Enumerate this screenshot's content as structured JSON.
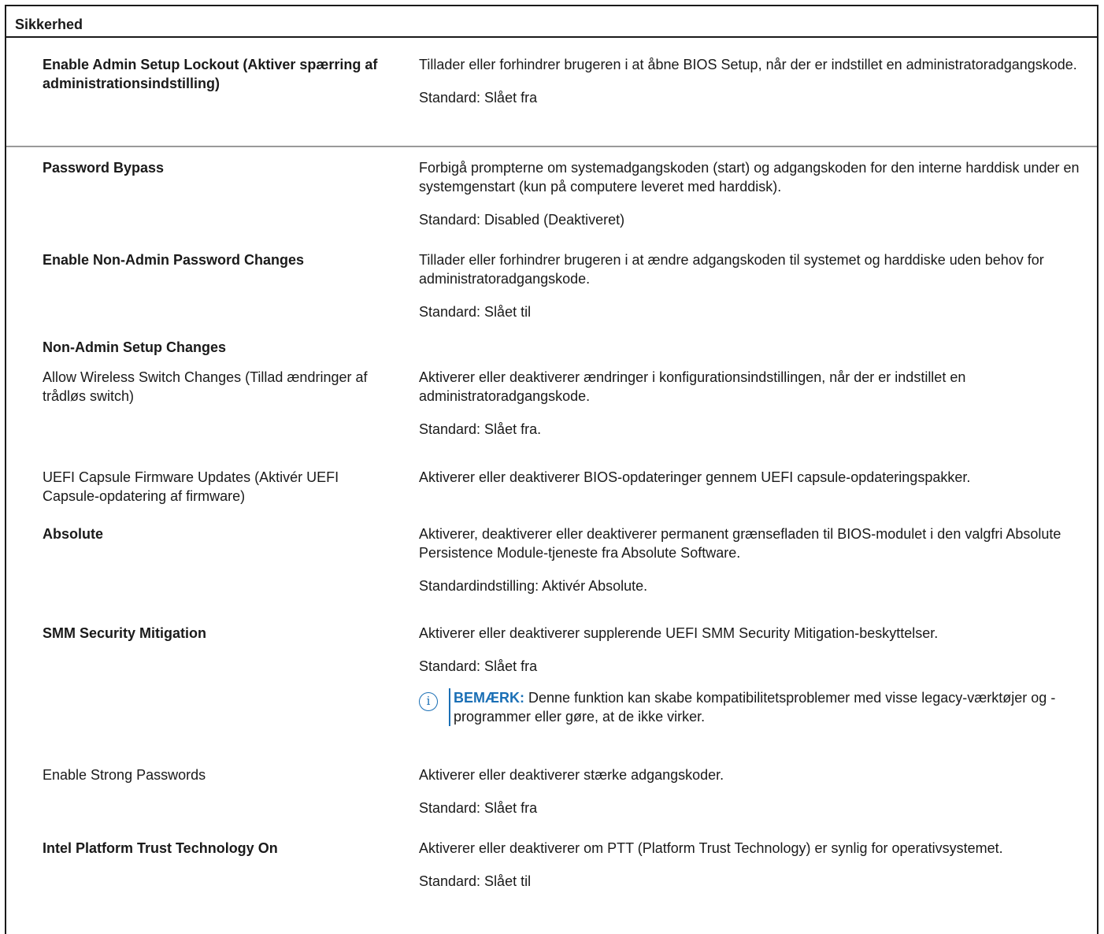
{
  "table": {
    "header": "Sikkerhed",
    "rows": [
      {
        "label": "Enable Admin Setup Lockout (Aktiver spærring af administrationsindstilling)",
        "description": "Tillader eller forhindrer brugeren i at åbne BIOS Setup, når der er indstillet en administratoradgangskode.",
        "default": "Standard: Slået fra"
      },
      {
        "label": "Password Bypass",
        "description": "Forbigå prompterne om systemadgangskoden (start) og adgangskoden for den interne harddisk under en systemgenstart (kun på computere leveret med harddisk).",
        "default": "Standard: Disabled (Deaktiveret)"
      },
      {
        "label": "Enable Non-Admin Password Changes",
        "description": "Tillader eller forhindrer brugeren i at ændre adgangskoden til systemet og harddiske uden behov for administratoradgangskode.",
        "default": "Standard: Slået til"
      },
      {
        "label": "Non-Admin Setup Changes"
      },
      {
        "label": "Allow Wireless Switch Changes (Tillad ændringer af trådløs switch)",
        "description": "Aktiverer eller deaktiverer ændringer i konfigurationsindstillingen, når der er indstillet en administratoradgangskode.",
        "default": "Standard: Slået fra."
      },
      {
        "label": "UEFI Capsule Firmware Updates (Aktivér UEFI Capsule-opdatering af firmware)",
        "description": "Aktiverer eller deaktiverer BIOS-opdateringer gennem UEFI capsule-opdateringspakker."
      },
      {
        "label": "Absolute",
        "description": "Aktiverer, deaktiverer eller deaktiverer permanent grænsefladen til BIOS-modulet i den valgfri Absolute Persistence Module-tjeneste fra Absolute Software.",
        "default": "Standardindstilling: Aktivér Absolute."
      },
      {
        "label": "SMM Security Mitigation",
        "description": "Aktiverer eller deaktiverer supplerende UEFI SMM Security Mitigation-beskyttelser.",
        "default": "Standard: Slået fra",
        "note": {
          "icon": "info-icon",
          "label": "BEMÆRK:",
          "text": "Denne funktion kan skabe kompatibilitetsproblemer med visse legacy-værktøjer og -programmer eller gøre, at de ikke virker."
        }
      },
      {
        "label": "Enable Strong Passwords",
        "description": "Aktiverer eller deaktiverer stærke adgangskoder.",
        "default": "Standard: Slået fra"
      },
      {
        "label": "Intel Platform Trust Technology On",
        "description": "Aktiverer eller deaktiverer om PTT (Platform Trust Technology) er synlig for operativsystemet.",
        "default": "Standard: Slået til"
      }
    ]
  },
  "colors": {
    "border": "#1a1a1a",
    "separator": "#9a9a9a",
    "note_accent": "#1a6fb5"
  }
}
